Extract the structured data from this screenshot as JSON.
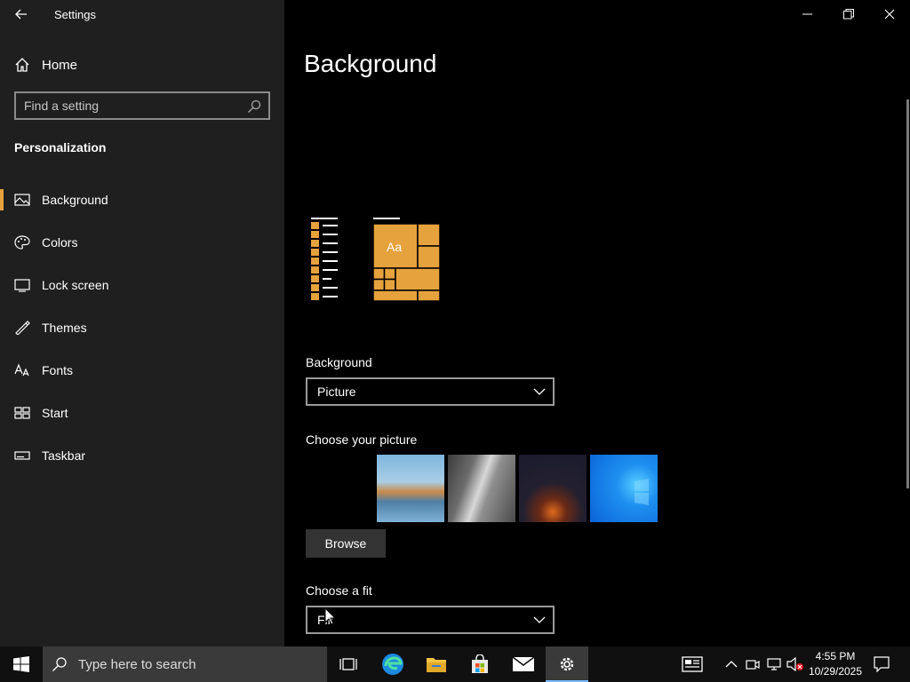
{
  "window": {
    "title": "Settings"
  },
  "sidebar": {
    "home_label": "Home",
    "search_placeholder": "Find a setting",
    "section_title": "Personalization",
    "items": [
      {
        "label": "Background",
        "icon": "picture-icon",
        "active": true
      },
      {
        "label": "Colors",
        "icon": "palette-icon"
      },
      {
        "label": "Lock screen",
        "icon": "lock-screen-icon"
      },
      {
        "label": "Themes",
        "icon": "themes-icon"
      },
      {
        "label": "Fonts",
        "icon": "fonts-icon"
      },
      {
        "label": "Start",
        "icon": "start-icon"
      },
      {
        "label": "Taskbar",
        "icon": "taskbar-icon"
      }
    ]
  },
  "main": {
    "title": "Background",
    "preview": {
      "sample_text": "Aa"
    },
    "background_label": "Background",
    "background_value": "Picture",
    "choose_picture_label": "Choose your picture",
    "browse_label": "Browse",
    "choose_fit_label": "Choose a fit",
    "fit_value": "Fill"
  },
  "taskbar": {
    "search_placeholder": "Type here to search",
    "time": "4:55 PM",
    "date": "10/29/2025"
  },
  "colors": {
    "accent": "#e6a23c",
    "sidebar_bg": "#1f1f1f",
    "main_bg": "#000000",
    "taskbar_bg": "#101010"
  }
}
